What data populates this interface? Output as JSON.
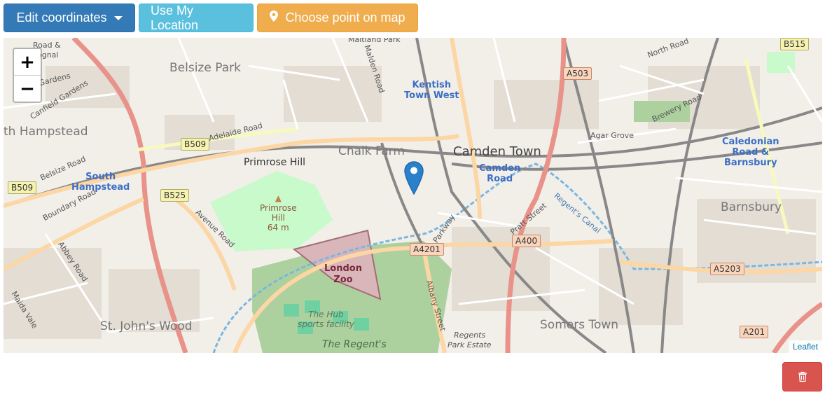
{
  "toolbar": {
    "edit_label": "Edit coordinates",
    "location_label": "Use My Location",
    "choose_label": "Choose point on map",
    "colors": {
      "primary": "#337ab7",
      "info": "#5bc0de",
      "warning": "#f0ad4e"
    }
  },
  "map": {
    "zoom_in": "+",
    "zoom_out": "−",
    "attribution": "Leaflet",
    "marker_icon": "map-marker-icon",
    "districts": {
      "belsize_park": "Belsize Park",
      "hampstead": "th Hampstead",
      "primrose_hill": "Primrose Hill",
      "chalk_farm": "Chalk Farm",
      "camden_town": "Camden Town",
      "barnsbury": "Barnsbury",
      "st_johns_wood": "St. John's Wood",
      "somers_town": "Somers Town",
      "regents_park": "The Regent's"
    },
    "stations": {
      "kentish": [
        "Kentish",
        "Town West"
      ],
      "south_hampstead": [
        "South",
        "Hampstead"
      ],
      "camden_road": [
        "Camden",
        "Road"
      ],
      "caledonian": [
        "Caledonian",
        "Road &",
        "Barnsbury"
      ]
    },
    "shields": {
      "b515": "B515",
      "a503": "A503",
      "b509a": "B509",
      "b509b": "B509",
      "b525": "B525",
      "a4201": "A4201",
      "a400": "A400",
      "a5203": "A5203",
      "a201": "A201"
    },
    "roads": {
      "adelaide": "Adelaide Road",
      "belsize": "Belsize Road",
      "boundary": "Boundary Road",
      "abbey": "Abbey Road",
      "maida": "Maida Vale",
      "avenue": "Avenue Road",
      "canfield": "Canfield Gardens",
      "agar": "Agar Grove",
      "brewery": "Brewery Road",
      "north": "North Road",
      "maitland": "Maitland Park",
      "malden": "Malden Road",
      "parkway": "Parkway",
      "albany": "Albany Street",
      "pratt": "Pratt Street",
      "regents_canal": "Regent's Canal",
      "regents_estate": "Regents",
      "regents_estate2": "Park Estate",
      "road_at": "Road &",
      "bognal": "ognal",
      "gardens": "Gardens"
    },
    "landmarks": {
      "primrose_hill_peak": [
        "Primrose",
        "Hill",
        "64 m"
      ],
      "london_zoo": [
        "London",
        "Zoo"
      ],
      "hub": [
        "The Hub",
        "sports facility"
      ]
    }
  },
  "delete_icon": "trash-icon"
}
